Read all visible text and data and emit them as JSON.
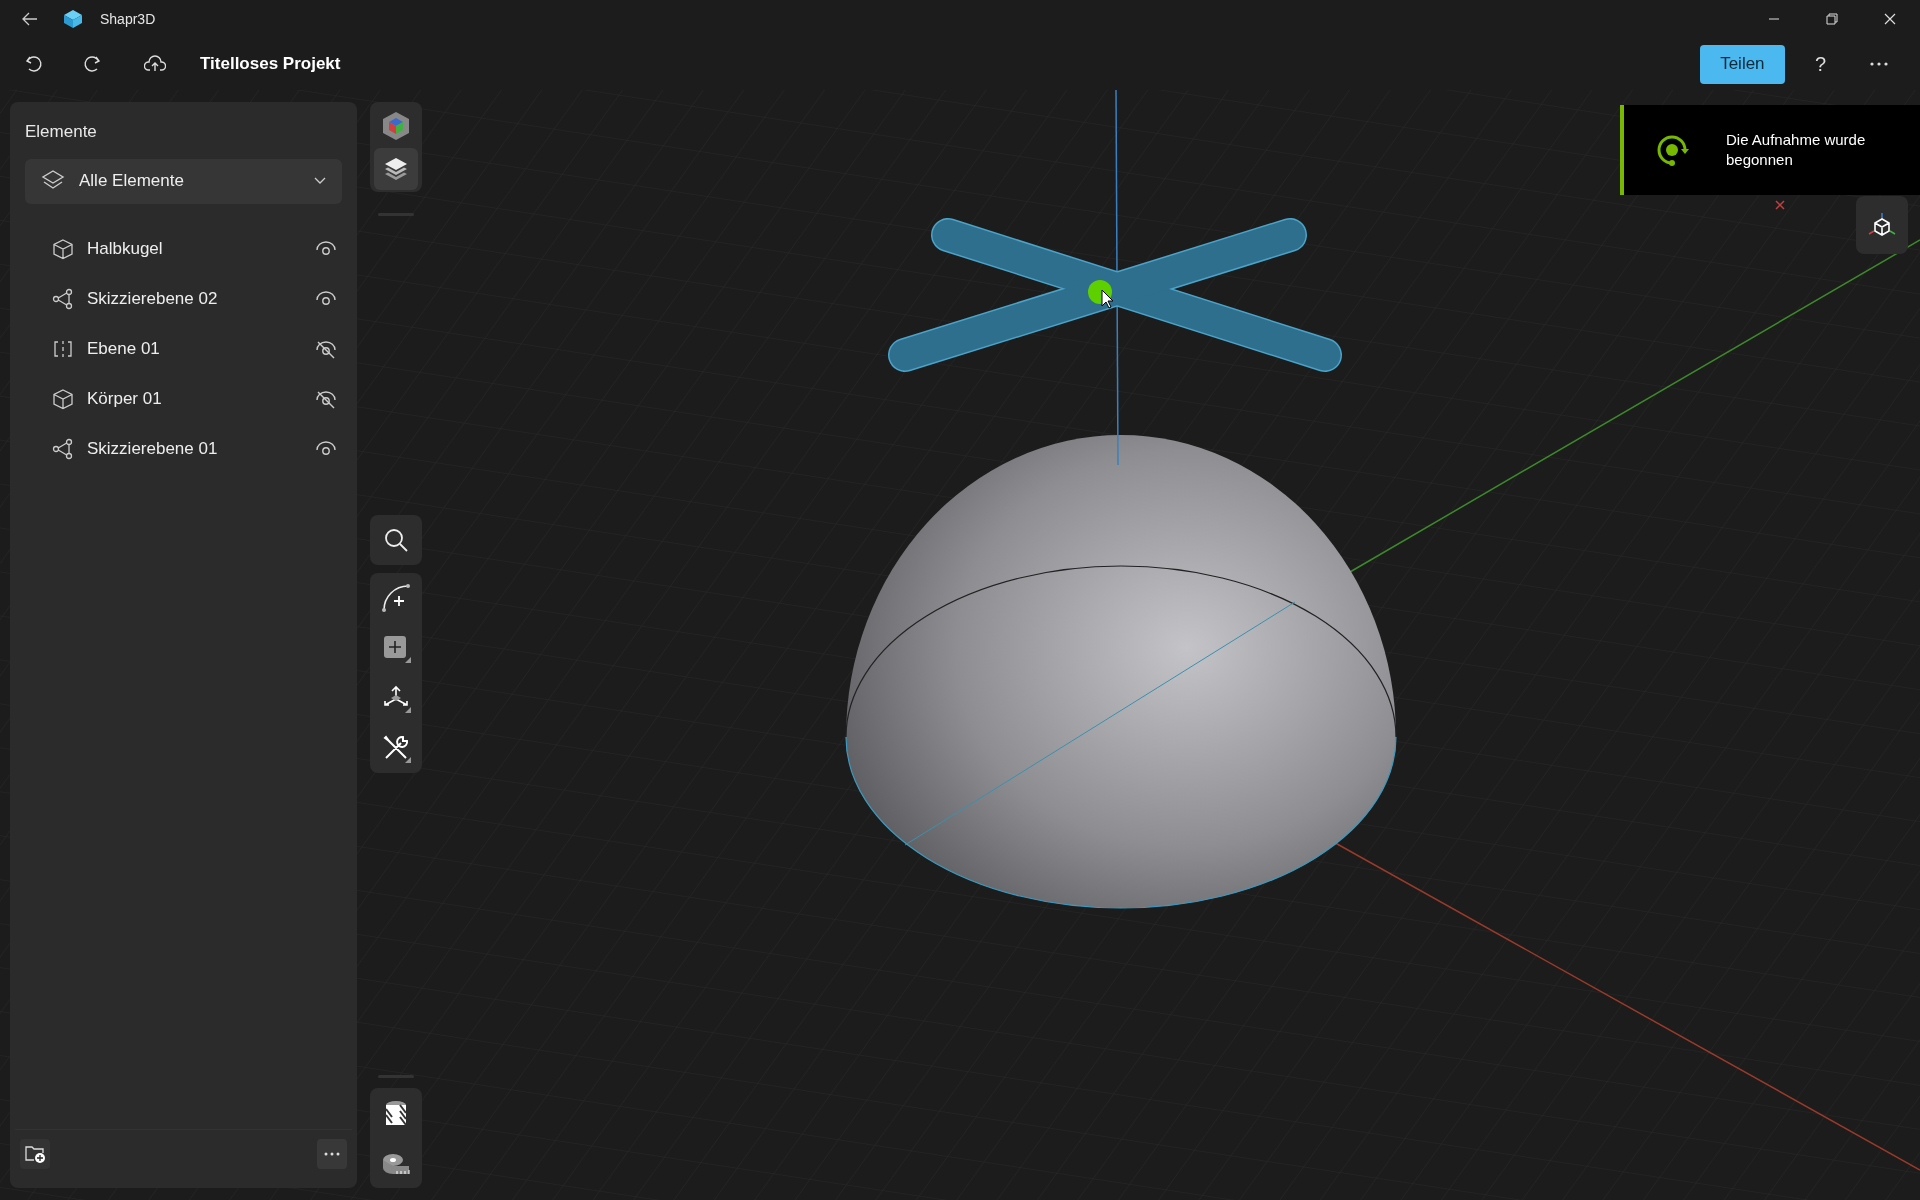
{
  "window": {
    "title": "Shapr3D"
  },
  "toolbar": {
    "project_title": "Titelloses Projekt",
    "share_button": "Teilen",
    "help_button": "?"
  },
  "elements_panel": {
    "title": "Elemente",
    "filter": "Alle Elemente",
    "items": [
      {
        "name": "Halbkugel",
        "kind": "body",
        "visible": true
      },
      {
        "name": "Skizzierebene 02",
        "kind": "sketch",
        "visible": true
      },
      {
        "name": "Ebene 01",
        "kind": "plane",
        "visible": false
      },
      {
        "name": "Körper 01",
        "kind": "body",
        "visible": false
      },
      {
        "name": "Skizzierebene 01",
        "kind": "sketch",
        "visible": true
      }
    ]
  },
  "notification": {
    "text": "Die Aufnahme wurde begonnen"
  }
}
